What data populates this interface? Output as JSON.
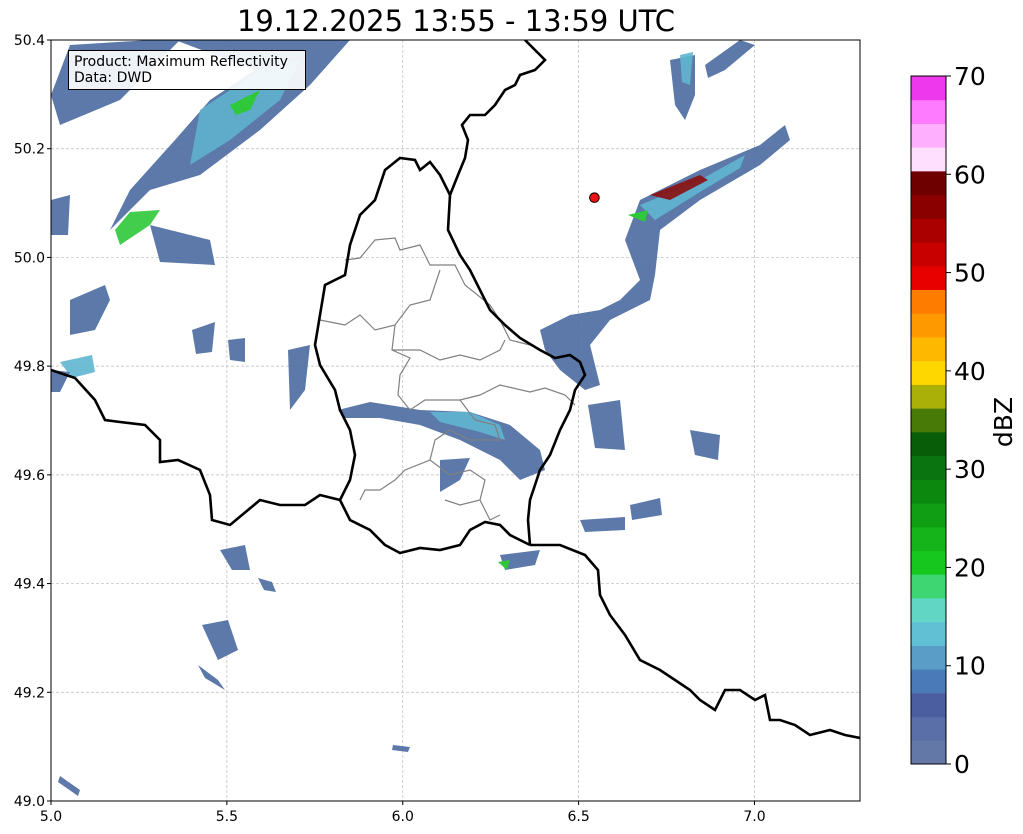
{
  "title": "19.12.2025 13:55 - 13:59 UTC",
  "info_box": {
    "product": "Product: Maximum Reflectivity",
    "data": "Data: DWD"
  },
  "axes": {
    "x_ticks": [
      "5.0",
      "5.5",
      "6.0",
      "6.5",
      "7.0"
    ],
    "y_ticks": [
      "50.4",
      "50.2",
      "50.0",
      "49.8",
      "49.6",
      "49.4",
      "49.2",
      "49.0"
    ],
    "x_range": [
      5.0,
      7.3
    ],
    "y_range": [
      49.0,
      50.4
    ],
    "grid": true
  },
  "colorbar": {
    "label": "dBZ",
    "tick_labels": [
      "0",
      "10",
      "20",
      "30",
      "40",
      "50",
      "60",
      "70"
    ],
    "range": [
      0,
      70
    ],
    "colors": [
      "#6478a8",
      "#5a6ea8",
      "#4a5ea0",
      "#4a7ab8",
      "#5a9ec8",
      "#62c0d4",
      "#62d6c4",
      "#3ed672",
      "#16c81e",
      "#14b41a",
      "#109e14",
      "#0c880e",
      "#0a7410",
      "#085e08",
      "#487a08",
      "#aab008",
      "#fed600",
      "#feb800",
      "#fe9a00",
      "#fe7c00",
      "#e80000",
      "#c80000",
      "#aa0000",
      "#8a0000",
      "#6e0000",
      "#fee0fe",
      "#feb0fe",
      "#fe7afe",
      "#ee38ee"
    ]
  },
  "marker": {
    "name": "site",
    "color": "#ee1111",
    "lon": 6.545,
    "lat": 50.11
  },
  "colors": {
    "border_country": "#000000",
    "border_canton": "#808080",
    "echo_main": "#4a6aa0",
    "echo_light": "#5fb5d0",
    "echo_green": "#2ec83a",
    "echo_darkred": "#8a1010"
  }
}
